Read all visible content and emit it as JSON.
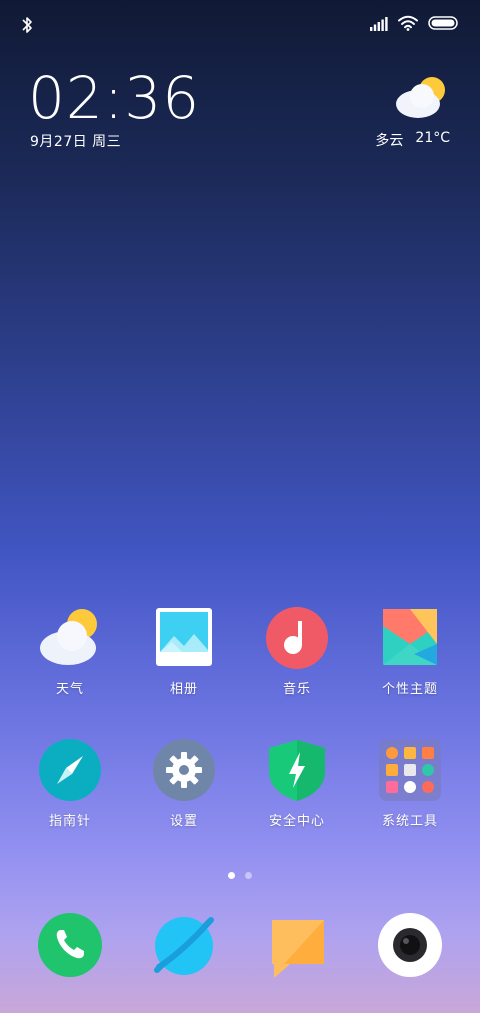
{
  "status_bar": {
    "bluetooth_icon": "bluetooth-icon",
    "signal_icon": "signal-icon",
    "wifi_icon": "wifi-icon",
    "battery_icon": "battery-icon"
  },
  "clock": {
    "time": "02:36",
    "date": "9月27日 周三"
  },
  "weather": {
    "icon": "partly-cloudy-icon",
    "condition": "多云",
    "temperature": "21°C"
  },
  "apps_row1": [
    {
      "label": "天气",
      "icon": "weather-icon"
    },
    {
      "label": "相册",
      "icon": "gallery-icon"
    },
    {
      "label": "音乐",
      "icon": "music-icon"
    },
    {
      "label": "个性主题",
      "icon": "themes-icon"
    }
  ],
  "apps_row2": [
    {
      "label": "指南针",
      "icon": "compass-icon"
    },
    {
      "label": "设置",
      "icon": "settings-icon"
    },
    {
      "label": "安全中心",
      "icon": "security-icon"
    },
    {
      "label": "系统工具",
      "icon": "folder-icon"
    }
  ],
  "page_indicator": {
    "count": 2,
    "active": 1
  },
  "dock": [
    {
      "icon": "phone-icon"
    },
    {
      "icon": "browser-icon"
    },
    {
      "icon": "messages-icon"
    },
    {
      "icon": "camera-icon"
    }
  ],
  "colors": {
    "phone": "#1fc46c",
    "browser": "#21c4f5",
    "messages": "#ffbe5e",
    "music": "#f05a66",
    "compass": "#0aaec0",
    "settings": "#6f86a8",
    "security": "#19c97a"
  }
}
